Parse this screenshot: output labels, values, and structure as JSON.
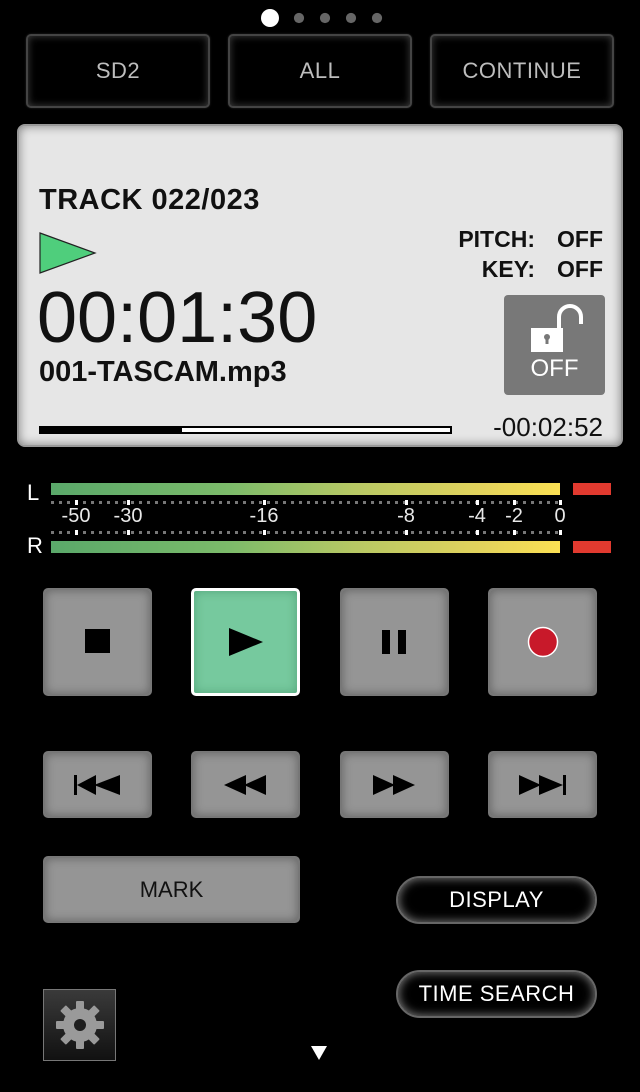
{
  "pager": {
    "count": 5,
    "active_index": 0
  },
  "mode_buttons": [
    {
      "label": "SD2"
    },
    {
      "label": "ALL"
    },
    {
      "label": "CONTINUE"
    }
  ],
  "lcd": {
    "track": "TRACK 022/023",
    "state_icon": "play-icon",
    "elapsed": "00:01:30",
    "filename": "001-TASCAM.mp3",
    "progress_fraction": 0.344,
    "remaining": "-00:02:52",
    "pitch_label": "PITCH:",
    "pitch_value": "OFF",
    "key_label": "KEY:",
    "key_value": "OFF",
    "lock": {
      "icon": "unlock-icon",
      "label": "OFF"
    }
  },
  "meter": {
    "channels": [
      "L",
      "R"
    ],
    "scale_labels": [
      "-50",
      "-30",
      "-16",
      "-8",
      "-4",
      "-2",
      "0"
    ],
    "peak_color": "#e13a2f"
  },
  "transport": {
    "stop": "stop-icon",
    "play": "play-icon",
    "pause": "pause-icon",
    "record": "record-icon",
    "skip_back": "skip-back-icon",
    "rewind": "rewind-icon",
    "fast_forward": "fast-forward-icon",
    "skip_forward": "skip-forward-icon",
    "active": "play",
    "active_color": "#76c99e",
    "record_color": "#c8192a"
  },
  "buttons": {
    "mark": "MARK",
    "display": "DISPLAY",
    "time_search": "TIME SEARCH"
  },
  "footer": {
    "settings_icon": "gear-icon",
    "more_icon": "down-arrow-icon"
  }
}
